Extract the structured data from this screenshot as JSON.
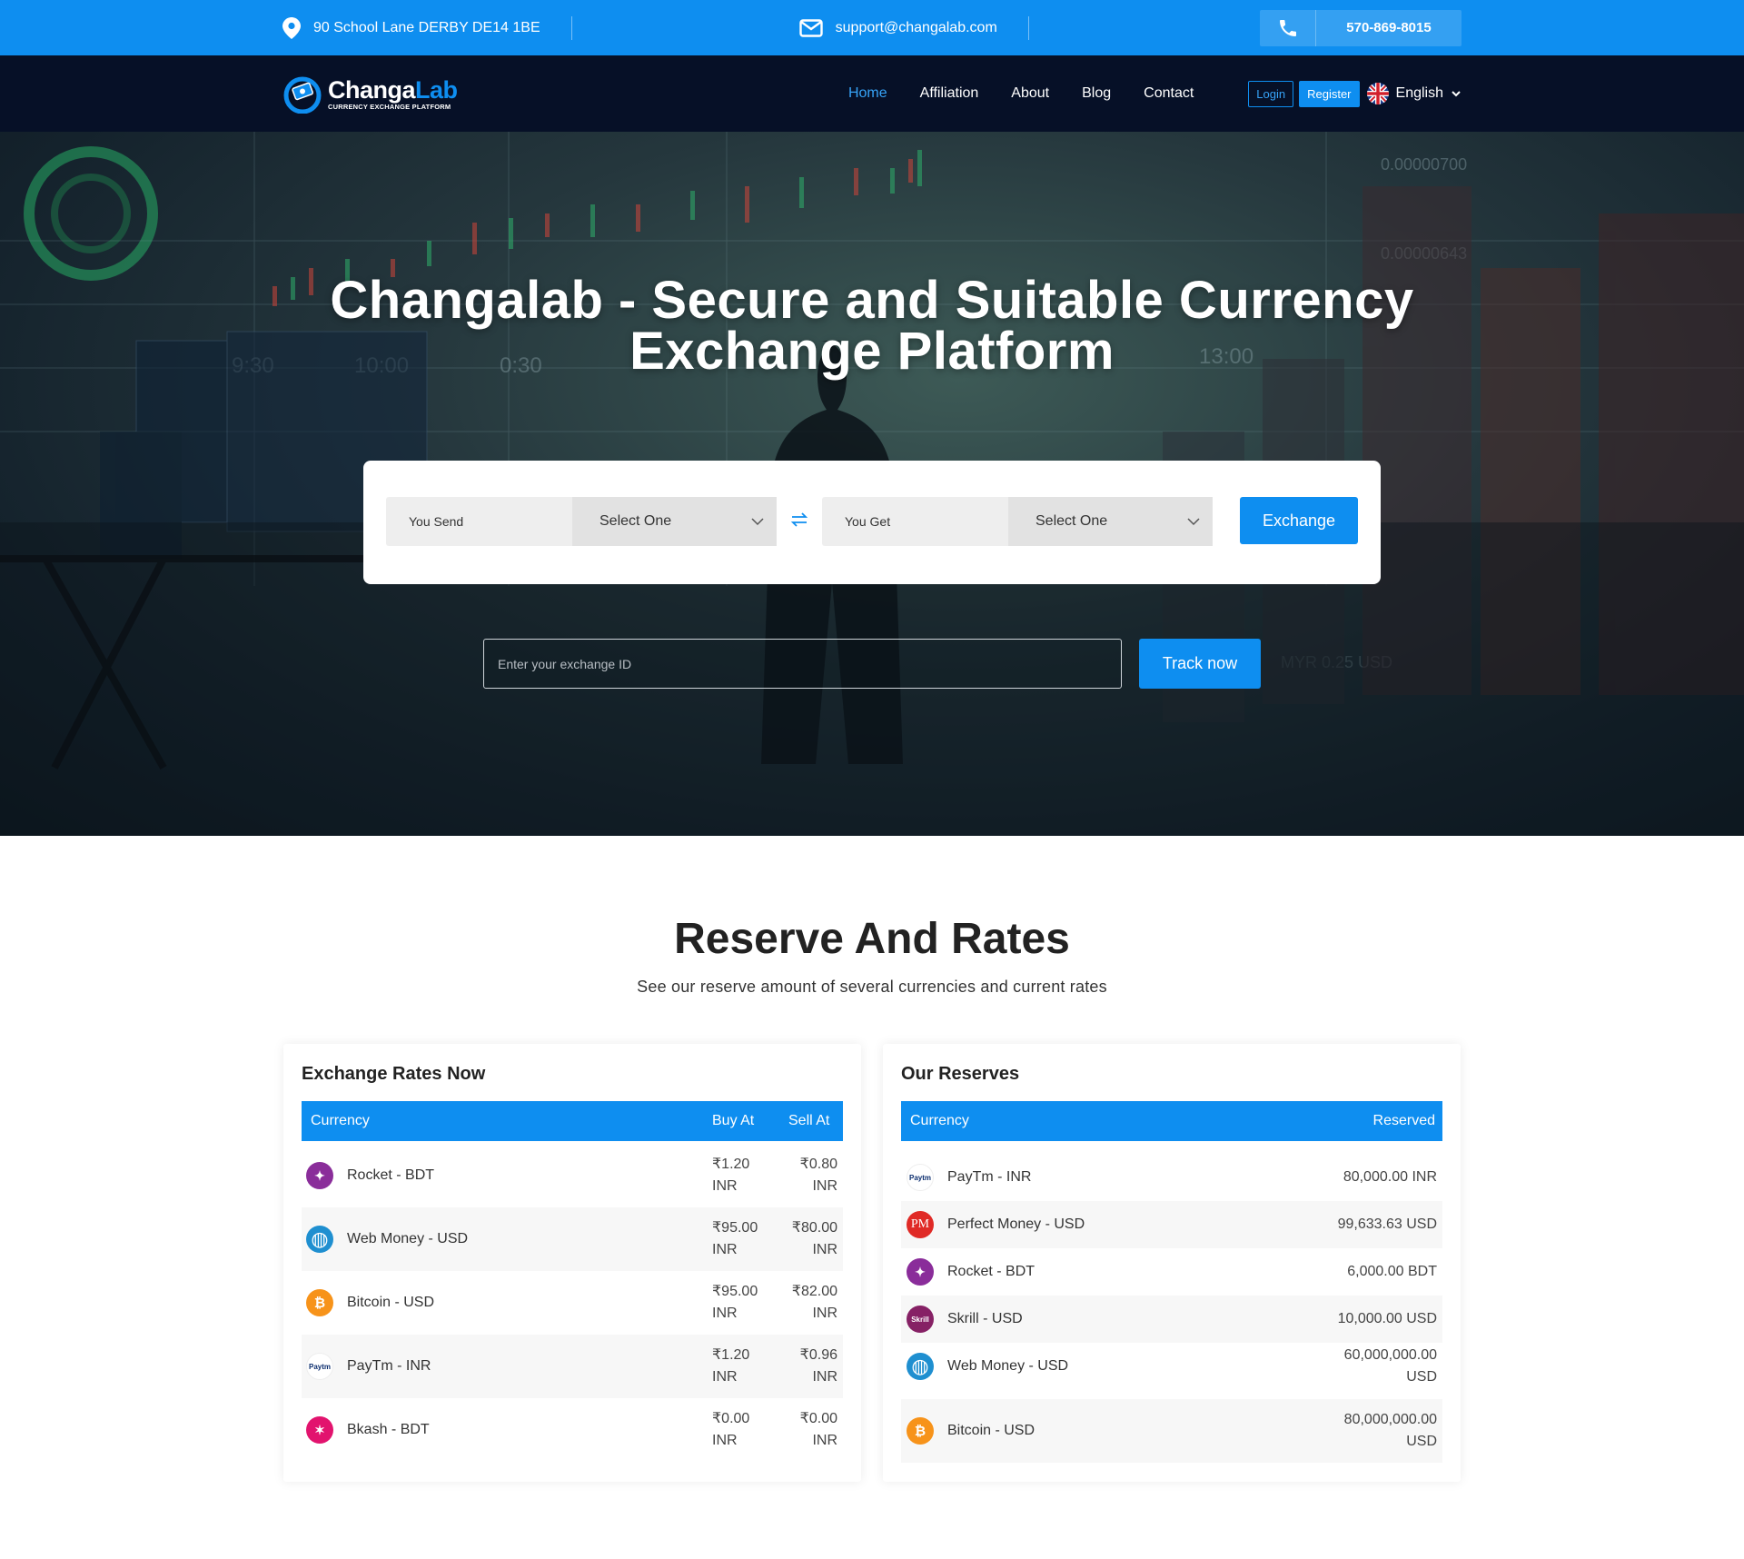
{
  "topbar": {
    "address": "90 School Lane DERBY DE14 1BE",
    "email": "support@changalab.com",
    "phone": "570-869-8015",
    "address_icon": "map-pin-icon",
    "email_icon": "envelope-icon",
    "phone_icon": "phone-icon"
  },
  "brand": {
    "name_part1": "Changa",
    "name_part2": "Lab",
    "tagline": "CURRENCY EXCHANGE PLATFORM"
  },
  "nav": {
    "items": [
      {
        "label": "Home",
        "active": true
      },
      {
        "label": "Affiliation",
        "active": false
      },
      {
        "label": "About",
        "active": false
      },
      {
        "label": "Blog",
        "active": false
      },
      {
        "label": "Contact",
        "active": false
      }
    ],
    "login": "Login",
    "register": "Register",
    "language": "English"
  },
  "hero": {
    "title_line1": "Changalab - Secure and Suitable Currency",
    "title_line2": "Exchange Platform",
    "you_send": "You Send",
    "you_get": "You Get",
    "send_select": "Select One",
    "get_select": "Select One",
    "exchange_button": "Exchange",
    "track_placeholder": "Enter your exchange ID",
    "track_button": "Track now"
  },
  "rates_section": {
    "title": "Reserve And Rates",
    "subtitle": "See our reserve amount of several currencies and current rates"
  },
  "exchange_rates": {
    "title": "Exchange Rates Now",
    "columns": [
      "Currency",
      "Buy At",
      "Sell At"
    ],
    "rows": [
      {
        "currency": "Rocket - BDT",
        "buy": "₹1.20",
        "buy_unit": "INR",
        "sell": "₹0.80",
        "sell_unit": "INR",
        "icon": "rocket-icon",
        "color": "#8a2d9a"
      },
      {
        "currency": "Web Money - USD",
        "buy": "₹95.00",
        "buy_unit": "INR",
        "sell": "₹80.00",
        "sell_unit": "INR",
        "icon": "webmoney-icon",
        "color": "#1f8fd0"
      },
      {
        "currency": "Bitcoin - USD",
        "buy": "₹95.00",
        "buy_unit": "INR",
        "sell": "₹82.00",
        "sell_unit": "INR",
        "icon": "bitcoin-icon",
        "color": "#f7931a"
      },
      {
        "currency": "PayTm - INR",
        "buy": "₹1.20",
        "buy_unit": "INR",
        "sell": "₹0.96",
        "sell_unit": "INR",
        "icon": "paytm-icon",
        "color": "#ffffff"
      },
      {
        "currency": "Bkash - BDT",
        "buy": "₹0.00",
        "buy_unit": "INR",
        "sell": "₹0.00",
        "sell_unit": "INR",
        "icon": "bkash-icon",
        "color": "#e2136e"
      }
    ]
  },
  "reserves": {
    "title": "Our Reserves",
    "columns": [
      "Currency",
      "Reserved"
    ],
    "rows": [
      {
        "currency": "PayTm - INR",
        "amount": "80,000.00 INR",
        "icon": "paytm-icon",
        "color": "#ffffff"
      },
      {
        "currency": "Perfect Money - USD",
        "amount": "99,633.63 USD",
        "icon": "perfect-money-icon",
        "color": "#e02a26"
      },
      {
        "currency": "Rocket - BDT",
        "amount": "6,000.00 BDT",
        "icon": "rocket-icon",
        "color": "#8a2d9a"
      },
      {
        "currency": "Skrill - USD",
        "amount": "10,000.00 USD",
        "icon": "skrill-icon",
        "color": "#862165"
      },
      {
        "currency": "Web Money - USD",
        "amount": "60,000,000.00",
        "amount_unit": "USD",
        "icon": "webmoney-icon",
        "color": "#1f8fd0"
      },
      {
        "currency": "Bitcoin - USD",
        "amount": "80,000,000.00",
        "amount_unit": "USD",
        "icon": "bitcoin-icon",
        "color": "#f7931a"
      }
    ]
  },
  "colors": {
    "primary": "#0e8ef0",
    "navbar": "#061027"
  }
}
